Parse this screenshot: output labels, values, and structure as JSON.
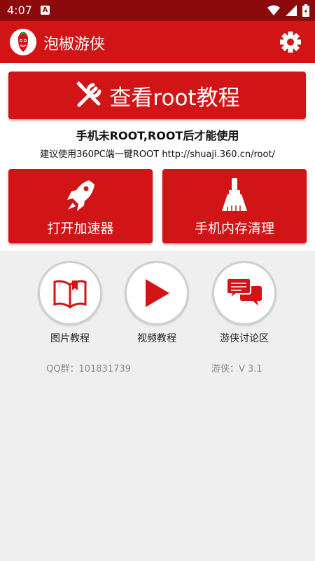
{
  "status_bar": {
    "time": "4:07",
    "notification": "A"
  },
  "app_bar": {
    "title": "泡椒游侠"
  },
  "root_button": {
    "label": "查看root教程"
  },
  "root_notice": "手机未ROOT,ROOT后才能使用",
  "root_suggest": "建议使用360PC端一键ROOT http://shuaji.360.cn/root/",
  "actions": [
    {
      "label": "打开加速器"
    },
    {
      "label": "手机内存清理"
    }
  ],
  "shortcuts": [
    {
      "label": "图片教程"
    },
    {
      "label": "视频教程"
    },
    {
      "label": "游侠讨论区"
    }
  ],
  "footer": {
    "qq": "QQ群：101831739",
    "version": "游侠：V 3.1"
  },
  "colors": {
    "primary": "#d11416",
    "status_bar": "#8c0a0b",
    "background": "#efefef"
  }
}
